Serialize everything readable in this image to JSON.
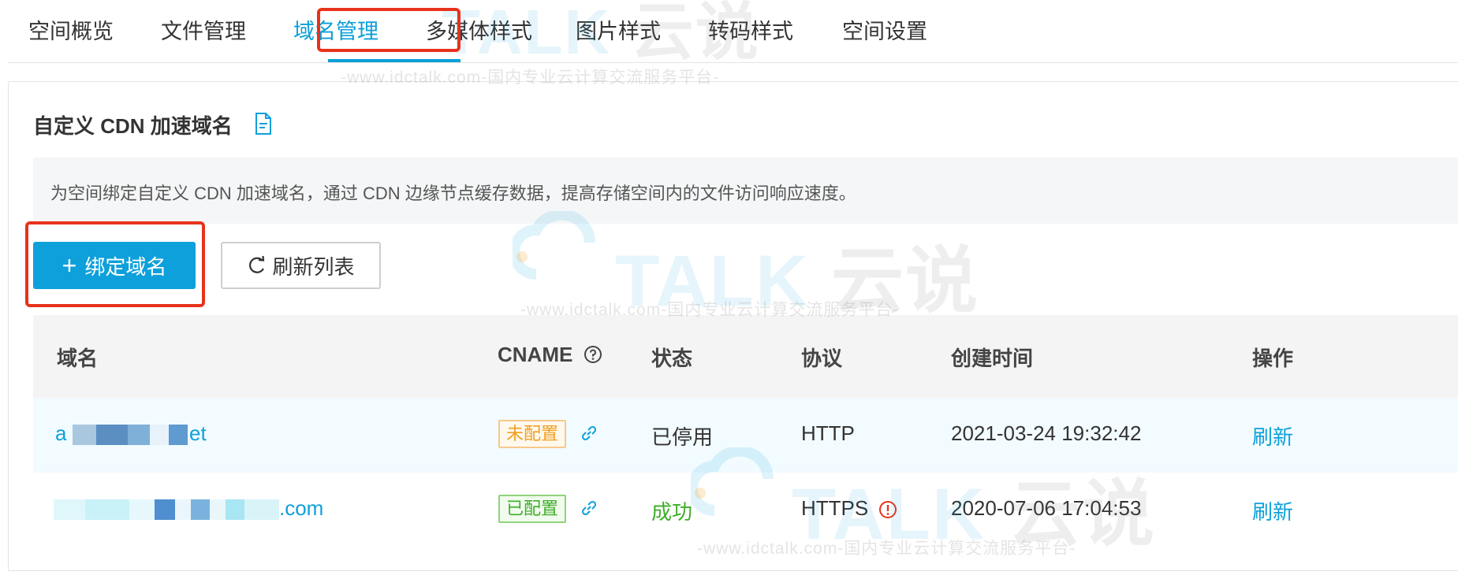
{
  "tabs": [
    {
      "label": "空间概览"
    },
    {
      "label": "文件管理"
    },
    {
      "label": "域名管理"
    },
    {
      "label": "多媒体样式"
    },
    {
      "label": "图片样式"
    },
    {
      "label": "转码样式"
    },
    {
      "label": "空间设置"
    }
  ],
  "watermark": {
    "logo_main": "TALK",
    "logo_cn": "云说",
    "text": "-www.idctalk.com-国内专业云计算交流服务平台-"
  },
  "section": {
    "title": "自定义 CDN 加速域名",
    "notice": "为空间绑定自定义 CDN 加速域名，通过 CDN 边缘节点缓存数据，提高存储空间内的文件访问响应速度。"
  },
  "toolbar": {
    "bind_label": "绑定域名",
    "refresh_label": "刷新列表"
  },
  "table": {
    "columns": [
      "域名",
      "CNAME",
      "状态",
      "协议",
      "创建时间",
      "操作"
    ],
    "rows": [
      {
        "domain_prefix": "a",
        "domain_suffix": "et",
        "cname": "未配置",
        "status": "已停用",
        "protocol": "HTTP",
        "created": "2021-03-24 19:32:42",
        "action": "刷新"
      },
      {
        "domain_prefix": "",
        "domain_suffix": ".com",
        "cname": "已配置",
        "status": "成功",
        "protocol": "HTTPS",
        "created": "2020-07-06 17:04:53",
        "action": "刷新"
      }
    ]
  },
  "colors": {
    "accent": "#0ea0db",
    "highlight": "#e8321b",
    "success": "#3fae29",
    "warning": "#f0a020"
  }
}
